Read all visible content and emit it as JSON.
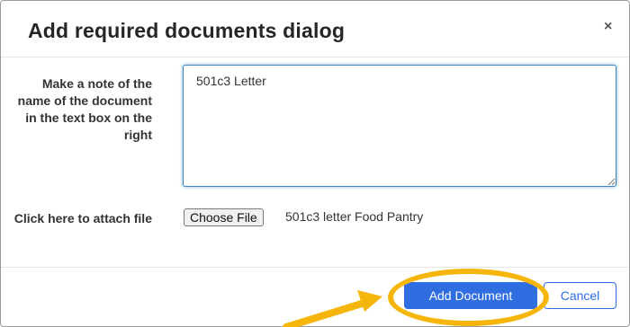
{
  "dialog": {
    "title": "Add required documents dialog",
    "close_glyph": "×",
    "note_label": "Make a note of the name of the document in the text box on the right",
    "note_value": "501c3 Letter",
    "attach_label": "Click here to attach file",
    "choose_file_label": "Choose File",
    "file_name": "501c3 letter Food Pantry",
    "add_button_label": "Add Document",
    "cancel_button_label": "Cancel"
  },
  "annotation": {
    "highlight_color": "#f5b50a",
    "arrow_icon": "arrow-pointer-icon"
  },
  "colors": {
    "primary": "#2f6de1",
    "focus_border": "#3b82c4"
  }
}
